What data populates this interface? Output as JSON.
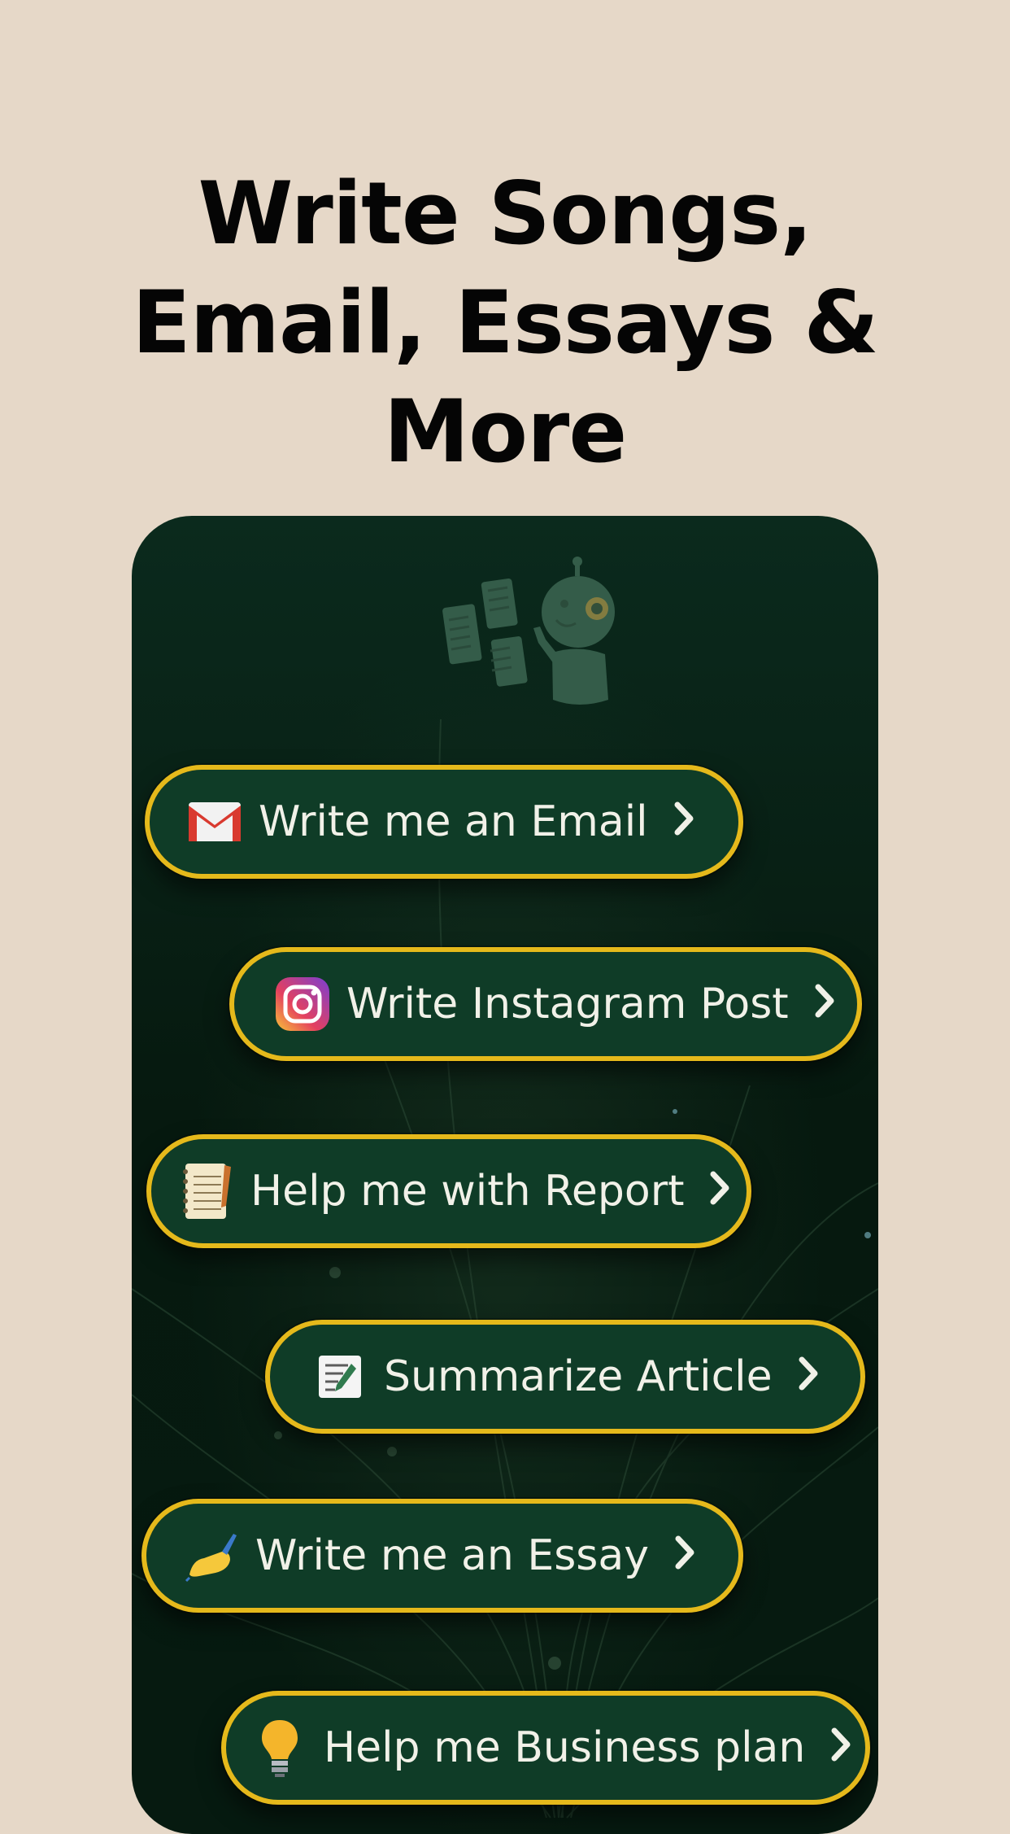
{
  "headline": {
    "line1": "Write Songs,",
    "line2": "Email, Essays &",
    "line3": "More"
  },
  "colors": {
    "background": "#e6d8c8",
    "panel": "#0b2a1d",
    "pill": "#0f3c27",
    "pill_border": "#e5b91b",
    "text": "#f1f1e8"
  },
  "options": [
    {
      "label": "Write me an Email",
      "icon": "gmail-icon"
    },
    {
      "label": "Write Instagram Post",
      "icon": "instagram-icon"
    },
    {
      "label": "Help me with Report",
      "icon": "notebook-icon"
    },
    {
      "label": "Summarize Article",
      "icon": "memo-icon"
    },
    {
      "label": "Write me an Essay",
      "icon": "writing-hand-icon"
    },
    {
      "label": "Help me Business plan",
      "icon": "lightbulb-icon"
    }
  ],
  "illustration": {
    "icon": "robot-with-documents-icon"
  }
}
